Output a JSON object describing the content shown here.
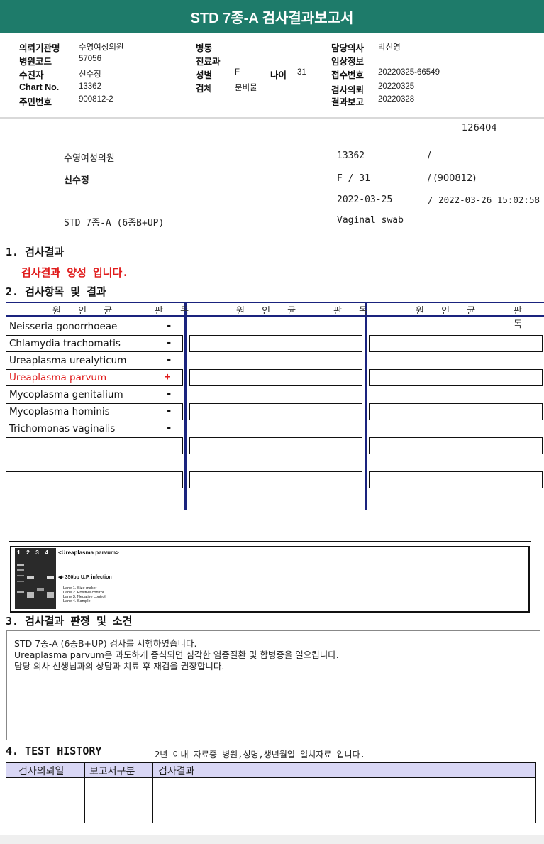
{
  "title": "STD 7종-A 검사결과보고서",
  "header": {
    "hospital_label": "의뢰기관명",
    "hospital_value": "수영여성의원",
    "code_label": "병원코드",
    "code_value": "57056",
    "patient_label": "수진자",
    "patient_value": "신수정",
    "chart_label": "Chart No.",
    "chart_value": "13362",
    "rrn_label": "주민번호",
    "rrn_value": "900812-2",
    "ward_label": "병동",
    "ward_value": "",
    "dept_label": "진료과",
    "dept_value": "",
    "sex_label": "성별",
    "sex_value": "F",
    "age_label": "나이",
    "age_value": "31",
    "specimen_label": "검체",
    "specimen_value": "분비물",
    "doctor_label": "담당의사",
    "doctor_value": "박신영",
    "clinical_label": "임상정보",
    "clinical_value": "",
    "receipt_label": "접수번호",
    "receipt_value": "20220325-66549",
    "request_label": "검사의뢰",
    "request_value": "20220325",
    "report_label": "결과보고",
    "report_value": "20220328"
  },
  "info": {
    "id": "126404",
    "hospital": "수영여성의원",
    "chart": "13362",
    "slash1": "/",
    "patient": "신수정",
    "sex_age": "F  /  31",
    "birth": "/ (900812)",
    "request_date": "2022-03-25",
    "report_datetime": "/  2022-03-26 15:02:58",
    "test_name": "STD 7종-A (6종B+UP)",
    "specimen": "Vaginal swab"
  },
  "section1": {
    "title": "1. 검사결과",
    "result": "검사결과 양성 입니다."
  },
  "section2": {
    "title": "2. 검사항목 및 결과",
    "col_organism": "원 인 균",
    "col_judge": "판 독",
    "rows": [
      {
        "name": "Neisseria gonorrhoeae",
        "result": "-"
      },
      {
        "name": "Chlamydia trachomatis",
        "result": "-"
      },
      {
        "name": "Ureaplasma urealyticum",
        "result": "-"
      },
      {
        "name": "Ureaplasma parvum",
        "result": "+"
      },
      {
        "name": "Mycoplasma genitalium",
        "result": "-"
      },
      {
        "name": "Mycoplasma hominis",
        "result": "-"
      },
      {
        "name": "Trichomonas vaginalis",
        "result": "-"
      }
    ]
  },
  "gel": {
    "lanes": "1 2 3 4",
    "title": "<Ureaplasma parvum>",
    "band": "350bp U.P. infection",
    "legend1": "Lane 1. Size maker",
    "legend2": "Lane 2. Positive control",
    "legend3": "Lane 3. Negative control",
    "legend4": "Lane 4. Sample"
  },
  "section3": {
    "title": "3. 검사결과 판정 및 소견",
    "line1": "STD 7종-A (6종B+UP) 검사를 시행하였습니다.",
    "line2": "Ureaplasma parvum은  과도하게 증식되면 심각한 염증질환 및 합병증을 일으킵니다.",
    "line3": "담당 의사 선생님과의 상담과 치료 후 재검을 권장합니다."
  },
  "section4": {
    "title": "4. TEST HISTORY",
    "note": "2년 이내 자료중 병원,성명,생년월일 일치자료 입니다.",
    "col1": "검사의뢰일",
    "col2": "보고서구분",
    "col3": "검사결과"
  },
  "colors": {
    "brand": "#1e7b6a",
    "positive": "#e01c1c",
    "table_line": "#1a237e",
    "history_header": "#d9d7f5"
  }
}
